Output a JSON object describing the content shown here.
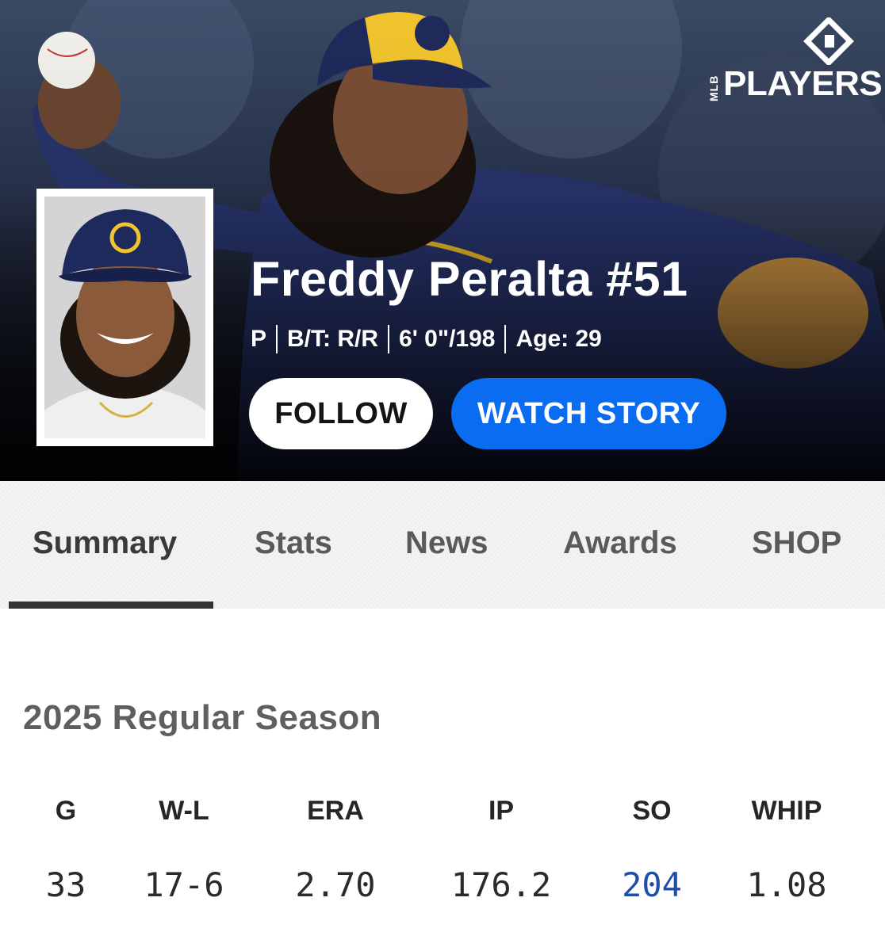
{
  "brand": {
    "logo_text": "PLAYERS",
    "logo_sub": "MLB",
    "logo_icon": "mlbpa-shield-icon"
  },
  "player": {
    "name": "Freddy Peralta #51",
    "position": "P",
    "bats_throws": "B/T: R/R",
    "height_weight": "6' 0\"/198",
    "age": "Age: 29",
    "photo_icon": "player-headshot"
  },
  "actions": {
    "follow_label": "FOLLOW",
    "watch_label": "WATCH STORY"
  },
  "tabs": [
    {
      "label": "Summary",
      "active": true
    },
    {
      "label": "Stats",
      "active": false
    },
    {
      "label": "News",
      "active": false
    },
    {
      "label": "Awards",
      "active": false
    },
    {
      "label": "SHOP",
      "active": false
    }
  ],
  "season": {
    "title": "2025 Regular Season",
    "stats": [
      {
        "label": "G",
        "value": "33"
      },
      {
        "label": "W-L",
        "value": "17-6"
      },
      {
        "label": "ERA",
        "value": "2.70"
      },
      {
        "label": "IP",
        "value": "176.2"
      },
      {
        "label": "SO",
        "value": "204",
        "link": true
      },
      {
        "label": "WHIP",
        "value": "1.08"
      }
    ]
  },
  "colors": {
    "watch_button": "#0a6cf0",
    "link_value": "#1d4fa8",
    "cap_navy": "#1f2a5c",
    "cap_gold": "#f2c230"
  }
}
